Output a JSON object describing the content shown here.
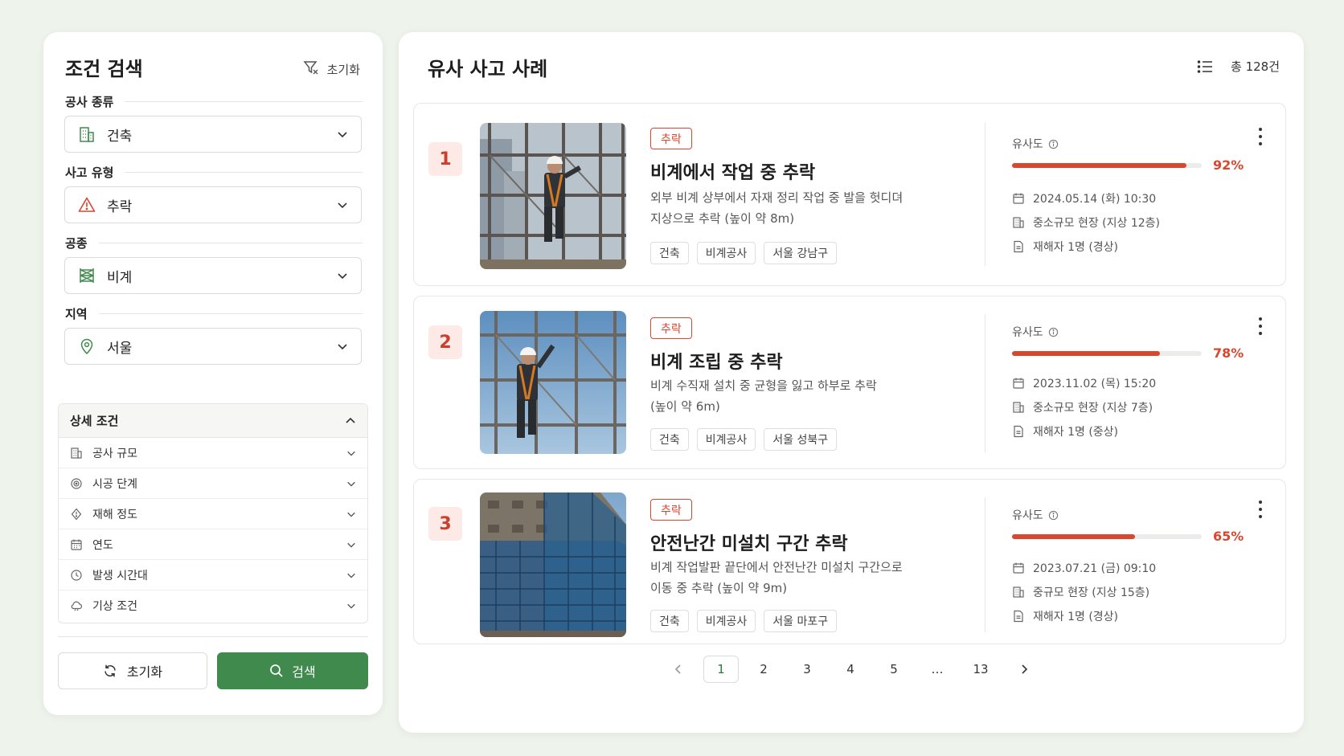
{
  "left": {
    "title": "조건 검색",
    "reset_label": "초기화",
    "fields": [
      {
        "label": "공사 종류",
        "value": "건축",
        "icon": "building-icon"
      },
      {
        "label": "사고 유형",
        "value": "추락",
        "icon": "warning-icon"
      },
      {
        "label": "공종",
        "value": "비계",
        "icon": "scaffold-icon"
      },
      {
        "label": "지역",
        "value": "서울",
        "icon": "location-pin-icon"
      }
    ],
    "detail": {
      "title": "상세 조건",
      "rows": [
        {
          "label": "공사 규모",
          "icon": "building-icon"
        },
        {
          "label": "시공 단계",
          "icon": "target-icon"
        },
        {
          "label": "재해 정도",
          "icon": "shield-alert-icon"
        },
        {
          "label": "연도",
          "icon": "calendar-icon"
        },
        {
          "label": "발생 시간대",
          "icon": "clock-icon"
        },
        {
          "label": "기상 조건",
          "icon": "cloud-icon"
        }
      ]
    },
    "btn_reset": "초기화",
    "btn_search": "검색"
  },
  "right": {
    "title": "유사 사고 사례",
    "total": "총 128건",
    "similarity_label": "유사도",
    "cards": [
      {
        "rank": "1",
        "badge": "추락",
        "title": "비계에서 작업 중 추락",
        "desc_line1": "외부 비계 상부에서 자재 정리 작업 중 발을 헛디뎌",
        "desc_line2": "지상으로 추락 (높이 약 8m)",
        "tags": [
          "건축",
          "비계공사",
          "서울 강남구"
        ],
        "similarity": 0.92,
        "similarity_text": "92%",
        "date": "2024.05.14 (화) 10:30",
        "site": "중소규모 현장 (지상 12층)",
        "victims": "재해자 1명 (경상)"
      },
      {
        "rank": "2",
        "badge": "추락",
        "title": "비계 조립 중 추락",
        "desc_line1": "비계 수직재 설치 중 균형을 잃고 하부로 추락",
        "desc_line2": "(높이 약 6m)",
        "tags": [
          "건축",
          "비계공사",
          "서울 성북구"
        ],
        "similarity": 0.78,
        "similarity_text": "78%",
        "date": "2023.11.02 (목) 15:20",
        "site": "중소규모 현장 (지상 7층)",
        "victims": "재해자 1명 (중상)"
      },
      {
        "rank": "3",
        "badge": "추락",
        "title": "안전난간 미설치 구간 추락",
        "desc_line1": "비계 작업발판 끝단에서 안전난간 미설치 구간으로",
        "desc_line2": "이동 중 추락 (높이 약 9m)",
        "tags": [
          "건축",
          "비계공사",
          "서울 마포구"
        ],
        "similarity": 0.65,
        "similarity_text": "65%",
        "date": "2023.07.21 (금) 09:10",
        "site": "중규모 현장 (지상 15층)",
        "victims": "재해자 1명 (경상)"
      }
    ],
    "pagination": [
      "1",
      "2",
      "3",
      "4",
      "5",
      "…",
      "13"
    ],
    "current_page": "1"
  },
  "colors": {
    "accent_green": "#3f8a4c",
    "danger_red": "#d9472f",
    "background": "#eef3ec"
  }
}
